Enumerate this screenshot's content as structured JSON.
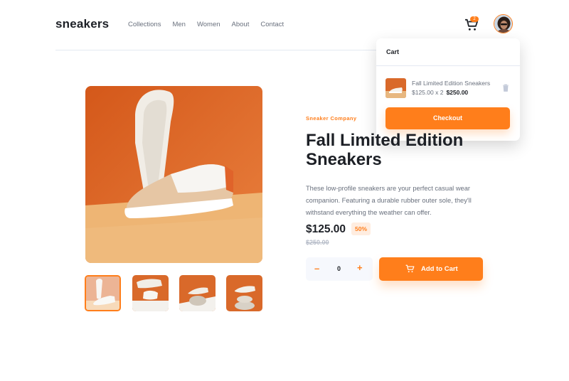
{
  "header": {
    "logo": "sneakers",
    "nav": [
      "Collections",
      "Men",
      "Women",
      "About",
      "Contact"
    ],
    "cart_count": "2"
  },
  "cart": {
    "title": "Cart",
    "item_name": "Fall Limited Edition Sneakers",
    "item_price": "$125.00 x 2",
    "item_total": "$250.00",
    "checkout_label": "Checkout"
  },
  "product": {
    "company": "Sneaker Company",
    "title": "Fall Limited Edition Sneakers",
    "description": "These low-profile sneakers are your perfect casual wear companion. Featuring a durable rubber outer sole, they'll withstand everything the weather can offer.",
    "price": "$125.00",
    "discount": "50%",
    "old_price": "$250.00",
    "quantity": "0",
    "add_label": "Add to Cart"
  },
  "icons": {
    "cart": "cart-icon",
    "trash": "trash-icon",
    "minus": "minus-icon",
    "plus": "plus-icon"
  },
  "colors": {
    "accent": "#ff7e1b",
    "accent_pale": "#ffede0",
    "text_dark": "#1d2026",
    "text_grey": "#69707d"
  }
}
